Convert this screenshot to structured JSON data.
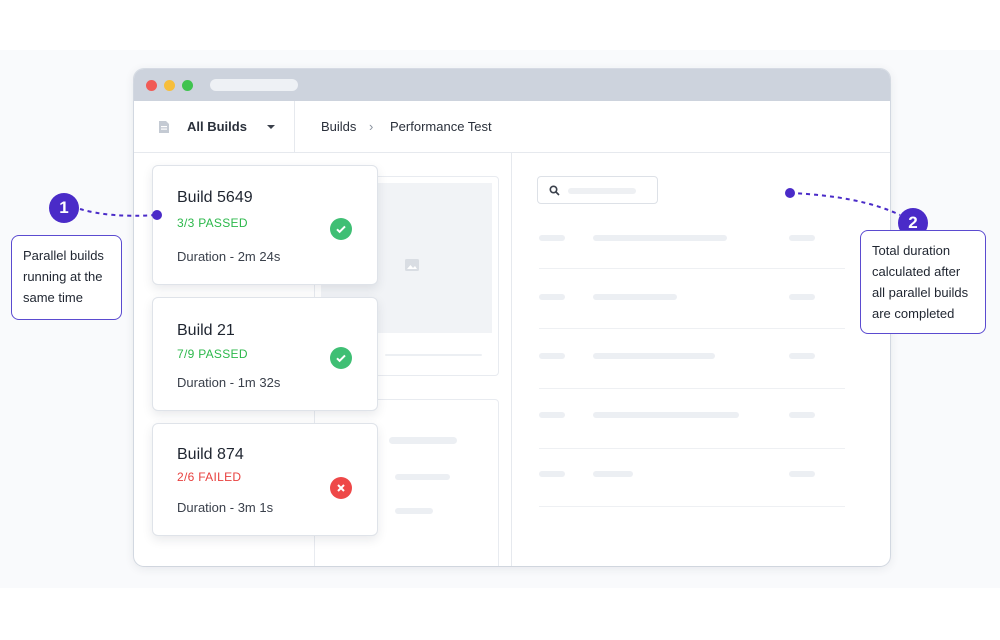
{
  "toolbar": {
    "builds_select_label": "All Builds",
    "breadcrumb_root": "Builds",
    "breadcrumb_separator": "›",
    "breadcrumb_current": "Performance Test"
  },
  "builds": [
    {
      "title": "Build 5649",
      "status": "3/3 PASSED",
      "result": "passed",
      "duration": "Duration - 2m 24s"
    },
    {
      "title": "Build 21",
      "status": "7/9 PASSED",
      "result": "passed",
      "duration": "Duration - 1m 32s"
    },
    {
      "title": "Build 874",
      "status": "2/6 FAILED",
      "result": "failed",
      "duration": "Duration - 3m 1s"
    }
  ],
  "annotations": [
    {
      "number": "1",
      "text_lines": [
        "Parallel builds",
        "running at the",
        "same time"
      ]
    },
    {
      "number": "2",
      "text_lines": [
        "Total duration",
        "calculated after",
        "all parallel builds",
        "are completed"
      ]
    }
  ],
  "colors": {
    "accent": "#4a2bc8",
    "passed": "#2cb84b",
    "failed": "#e8413f",
    "pass_icon": "#3fbf74",
    "fail_icon": "#ee4848"
  },
  "icons": {
    "builds_select": "document-icon",
    "dropdown": "caret-down-icon",
    "search": "search-icon",
    "passed": "check-circle-icon",
    "failed": "x-circle-icon"
  }
}
